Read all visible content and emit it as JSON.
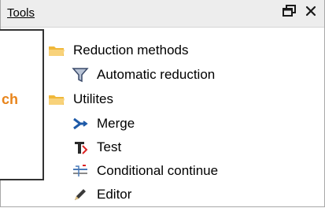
{
  "panel": {
    "title": "Tools",
    "float_glyph": "🗗",
    "close_glyph": "✕"
  },
  "tree": {
    "items": [
      {
        "label": "Reduction methods",
        "icon": "folder-icon"
      },
      {
        "label": "Automatic reduction",
        "icon": "filter-icon"
      },
      {
        "label": "Utilites",
        "icon": "folder-icon"
      },
      {
        "label": "Merge",
        "icon": "merge-icon"
      },
      {
        "label": "Test",
        "icon": "test-icon"
      },
      {
        "label": "Conditional continue",
        "icon": "conditional-continue-icon"
      },
      {
        "label": "Editor",
        "icon": "pencil-icon"
      }
    ]
  },
  "callout": {
    "text": "ch",
    "color": "#e8841a"
  },
  "colors": {
    "folder": "#f5c542",
    "title_bg": "#ededed",
    "icon_blue": "#1e5aa8"
  }
}
